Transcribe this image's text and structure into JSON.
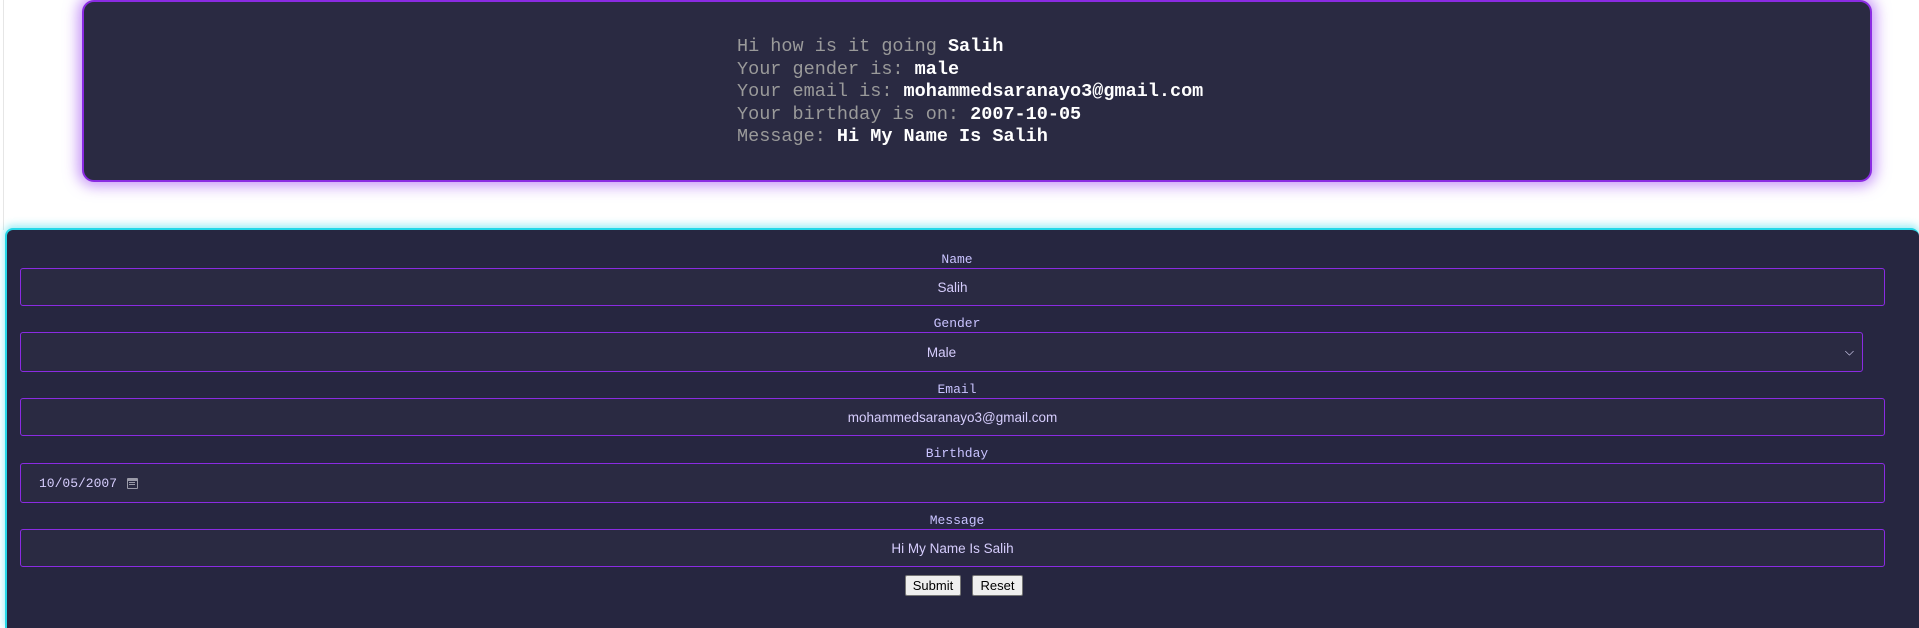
{
  "summary": {
    "line1_prefix": "Hi how is it going ",
    "line1_value": "Salih",
    "line2_prefix": "Your gender is: ",
    "line2_value": "male",
    "line3_prefix": "Your email is: ",
    "line3_value": "mohammedsaranayo3@gmail.com",
    "line4_prefix": "Your birthday is on: ",
    "line4_value": "2007-10-05",
    "line5_prefix": "Message: ",
    "line5_value": "Hi My Name Is Salih"
  },
  "form": {
    "name_label": "Name",
    "name_value": "Salih",
    "gender_label": "Gender",
    "gender_value": "Male",
    "email_label": "Email",
    "email_value": "mohammedsaranayo3@gmail.com",
    "birthday_label": "Birthday",
    "birthday_value": "10/05/2007",
    "message_label": "Message",
    "message_value": "Hi My Name Is Salih",
    "submit_label": "Submit",
    "reset_label": "Reset"
  },
  "colors": {
    "card_bg": "#2a2a42",
    "panel_bg": "#262640",
    "accent_purple": "#8a2be2",
    "accent_cyan": "#25d8e8",
    "label_text": "#c9c3ff"
  }
}
